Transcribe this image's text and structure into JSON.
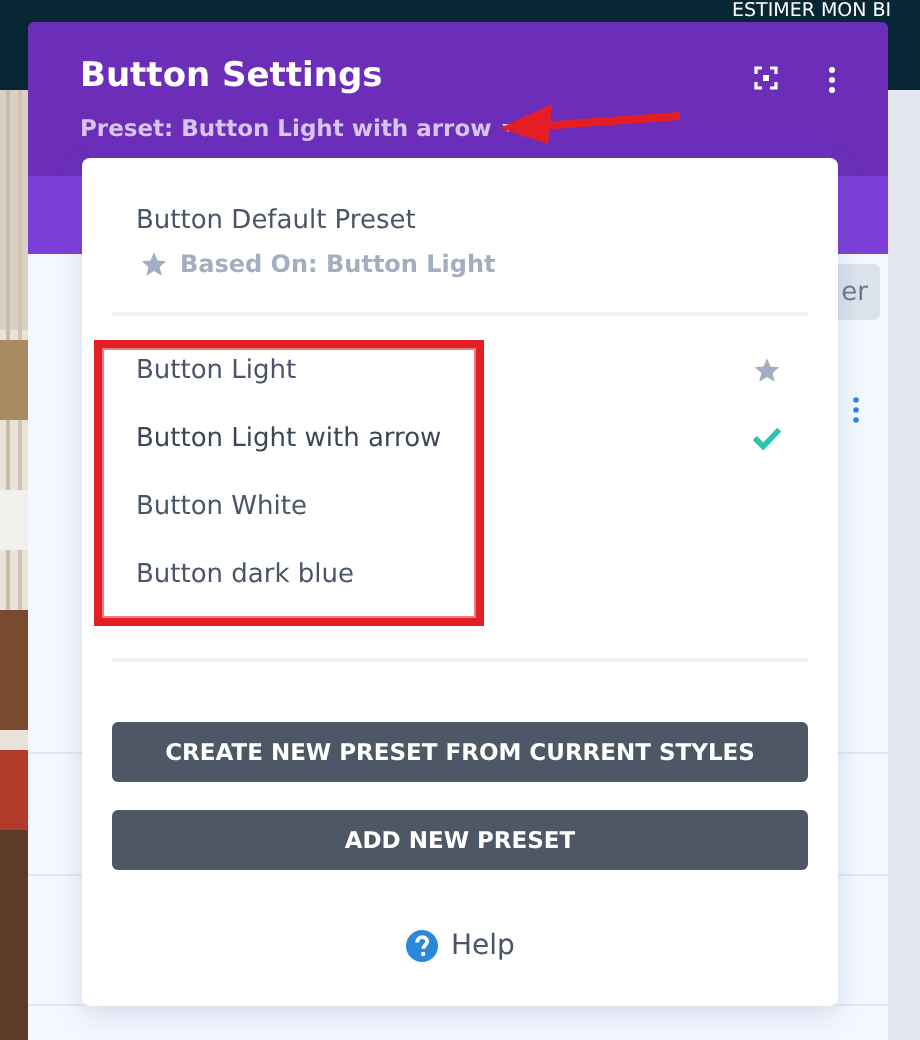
{
  "site_nav": {
    "link": "ESTIMER MON BI"
  },
  "panel": {
    "title": "Button Settings",
    "preset_label": "Preset: Button Light with arrow",
    "partial_button": "er"
  },
  "preset_menu": {
    "default_preset": {
      "name": "Button Default Preset",
      "based_on": "Based On: Button Light"
    },
    "presets": [
      {
        "name": "Button Light",
        "is_default": true,
        "selected": false
      },
      {
        "name": "Button Light with arrow",
        "is_default": false,
        "selected": true
      },
      {
        "name": "Button White",
        "is_default": false,
        "selected": false
      },
      {
        "name": "Button dark blue",
        "is_default": false,
        "selected": false
      }
    ],
    "actions": [
      "CREATE NEW PRESET FROM CURRENT STYLES",
      "ADD NEW PRESET"
    ],
    "help": "Help"
  },
  "annotations": {
    "highlight_frame": true,
    "pointer_arrow": true
  }
}
